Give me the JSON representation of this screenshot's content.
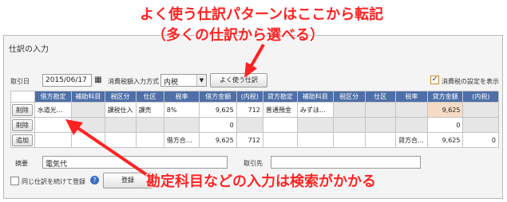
{
  "annotations": {
    "top_line1": "よく使う仕訳パターンはここから転記",
    "top_line2": "（多くの仕訳から選べる）",
    "bottom": "勘定科目などの入力は検索がかかる"
  },
  "panel": {
    "title": "仕訳の入力"
  },
  "header_row": {
    "date_label": "取引日",
    "date_value": "2015/06/17",
    "tax_method_label": "消費税額入力方式",
    "tax_method_value": "内税",
    "common_entry_button": "よく使う仕訳",
    "tax_setting_label": "消費税の設定を表示",
    "tax_setting_checked": true
  },
  "table": {
    "columns": [
      "借方勘定",
      "補助科目",
      "税区分",
      "仕区",
      "税率",
      "借方金額",
      "(内税)",
      "貸方勘定",
      "補助科目",
      "税区分",
      "仕区",
      "税率",
      "貸方金額",
      "(内税)"
    ],
    "rows": [
      {
        "action": "削除",
        "debit_account": "水道光…",
        "debit_sub": "",
        "debit_tax_class": "課税仕入",
        "debit_kubun": "課売",
        "debit_rate": "8%",
        "debit_amount": "9,625",
        "debit_tax": "712",
        "credit_account": "普通預金",
        "credit_sub": "みずほ…",
        "credit_tax_class": "",
        "credit_kubun": "",
        "credit_rate": "",
        "credit_amount": "9,625",
        "credit_tax": ""
      },
      {
        "action": "削除",
        "debit_account": "",
        "debit_sub": "",
        "debit_tax_class": "",
        "debit_kubun": "",
        "debit_rate": "",
        "debit_amount": "0",
        "debit_tax": "",
        "credit_account": "",
        "credit_sub": "",
        "credit_tax_class": "",
        "credit_kubun": "",
        "credit_rate": "",
        "credit_amount": "0",
        "credit_tax": ""
      }
    ],
    "totals": {
      "action": "追加",
      "debit_label": "借方合…",
      "debit_amount": "9,625",
      "debit_tax": "712",
      "credit_label": "貸方合…",
      "credit_amount": "9,625",
      "credit_tax": "0"
    }
  },
  "footer": {
    "memo_label": "摘要",
    "memo_value": "電気代",
    "partner_label": "取引先",
    "partner_value": "",
    "repeat_label": "同じ仕訳を続けて登録",
    "register_button": "登録",
    "help_icon": "?"
  },
  "colors": {
    "header_bg": "#4e6fa8",
    "annotation": "#ff2222",
    "salmon": "#f6dcc7",
    "checkbox_border": "#c98a2a"
  }
}
